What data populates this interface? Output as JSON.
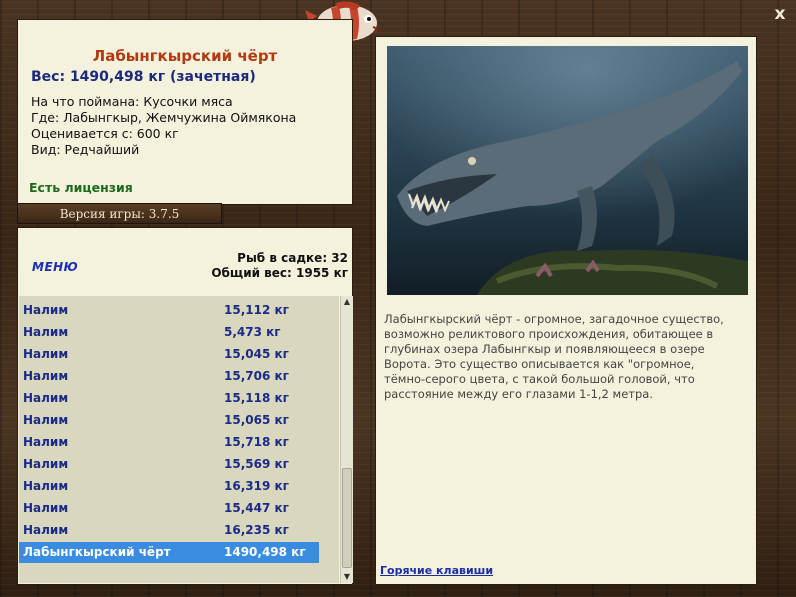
{
  "fish": {
    "name": "Лабынгкырский чёрт",
    "weight": "Вес: 1490,498 кг (зачетная)",
    "bait": "На что поймана: Кусочки мяса",
    "location": "Где: Лабынгкыр, Жемчужина Оймякона",
    "value": "Оценивается с: 600 кг",
    "type": "Вид: Редчайший",
    "license": "Есть лицензия"
  },
  "version": "Версия игры: 3.7.5",
  "menu": {
    "label": "меню"
  },
  "stats": {
    "count": "Рыб в садке: 32",
    "total": "Общий вес: 1955 кг"
  },
  "list": [
    {
      "name": "Налим",
      "weight": "15,112 кг"
    },
    {
      "name": "Налим",
      "weight": "5,473 кг"
    },
    {
      "name": "Налим",
      "weight": "15,045 кг"
    },
    {
      "name": "Налим",
      "weight": "15,706 кг"
    },
    {
      "name": "Налим",
      "weight": "15,118 кг"
    },
    {
      "name": "Налим",
      "weight": "15,065 кг"
    },
    {
      "name": "Налим",
      "weight": "15,718 кг"
    },
    {
      "name": "Налим",
      "weight": "15,569 кг"
    },
    {
      "name": "Налим",
      "weight": "16,319 кг"
    },
    {
      "name": "Налим",
      "weight": "15,447 кг"
    },
    {
      "name": "Налим",
      "weight": "16,235 кг"
    },
    {
      "name": "Лабынгкырский чёрт",
      "weight": "1490,498 кг"
    }
  ],
  "description": "Лабынгкырский чёрт - огромное, загадочное существо, возможно реликтового происхождения, обитающее в глубинах озера Лабынгкыр и появляющееся в озере Ворота. Это существо описывается как \"огромное, тёмно-серого цвета, с такой большой головой, что расстояние между его глазами 1-1,2 метра.",
  "hotkeys": "Горячие клавиши",
  "close_glyph": "x",
  "colors": {
    "accent": "#b23a10",
    "link": "#1a2eb8",
    "selected": "#3a8ce0",
    "panel": "#f4f1dc"
  }
}
